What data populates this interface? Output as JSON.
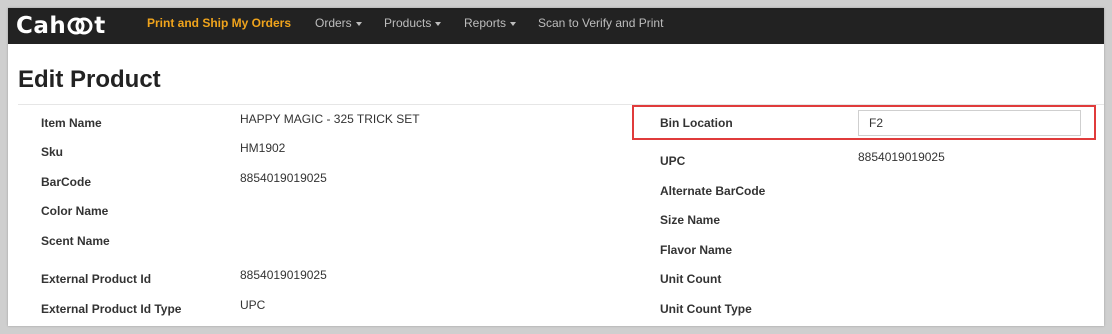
{
  "nav": {
    "logo": "Cahoot",
    "items": [
      {
        "label": "Print and Ship My Orders",
        "active": true,
        "dropdown": false
      },
      {
        "label": "Orders",
        "active": false,
        "dropdown": true
      },
      {
        "label": "Products",
        "active": false,
        "dropdown": true
      },
      {
        "label": "Reports",
        "active": false,
        "dropdown": true
      },
      {
        "label": "Scan to Verify and Print",
        "active": false,
        "dropdown": false
      }
    ]
  },
  "page_title": "Edit Product",
  "left_fields": [
    {
      "label": "Item Name",
      "value": "HAPPY MAGIC - 325 TRICK SET"
    },
    {
      "label": "Sku",
      "value": "HM1902"
    },
    {
      "label": "BarCode",
      "value": "8854019019025"
    },
    {
      "label": "Color Name",
      "value": ""
    },
    {
      "label": "Scent Name",
      "value": ""
    },
    {
      "label": "External Product Id",
      "value": "8854019019025"
    },
    {
      "label": "External Product Id Type",
      "value": "UPC"
    }
  ],
  "right_fields": [
    {
      "label": "Bin Location",
      "value": "F2",
      "editable": true
    },
    {
      "label": "UPC",
      "value": "8854019019025"
    },
    {
      "label": "Alternate BarCode",
      "value": ""
    },
    {
      "label": "Size Name",
      "value": ""
    },
    {
      "label": "Flavor Name",
      "value": ""
    },
    {
      "label": "Unit Count",
      "value": ""
    },
    {
      "label": "Unit Count Type",
      "value": ""
    }
  ],
  "colors": {
    "navbar": "#222222",
    "nav_active": "#f0a41c",
    "highlight": "#e03b3b"
  }
}
